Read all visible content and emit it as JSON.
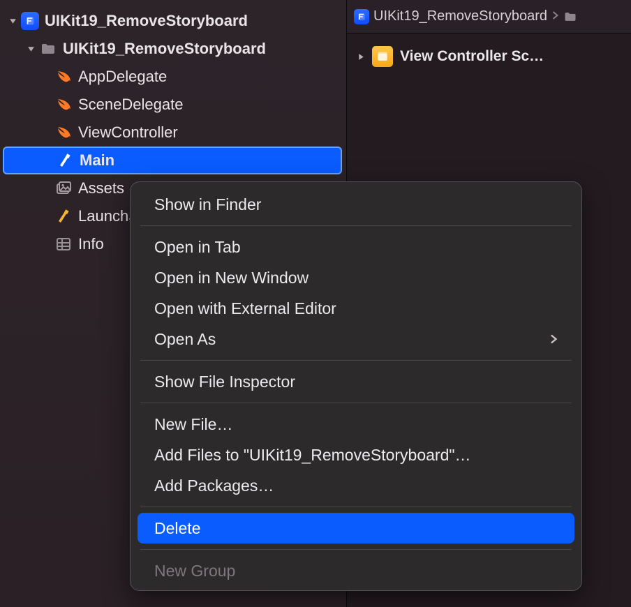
{
  "navigator": {
    "project": "UIKit19_RemoveStoryboard",
    "folder": "UIKit19_RemoveStoryboard",
    "files": {
      "appdelegate": "AppDelegate",
      "scenedelegate": "SceneDelegate",
      "viewcontroller": "ViewController",
      "main": "Main",
      "assets": "Assets",
      "launchscreen": "LaunchScreen",
      "info": "Info"
    }
  },
  "breadcrumb": {
    "item": "UIKit19_RemoveStoryboard"
  },
  "outline": {
    "label": "View Controller Sc…"
  },
  "context_menu": {
    "show_in_finder": "Show in Finder",
    "open_in_tab": "Open in Tab",
    "open_in_new_window": "Open in New Window",
    "open_with_external_editor": "Open with External Editor",
    "open_as": "Open As",
    "show_file_inspector": "Show File Inspector",
    "new_file": "New File…",
    "add_files_to": "Add Files to \"UIKit19_RemoveStoryboard\"…",
    "add_packages": "Add Packages…",
    "delete": "Delete",
    "new_group": "New Group"
  }
}
